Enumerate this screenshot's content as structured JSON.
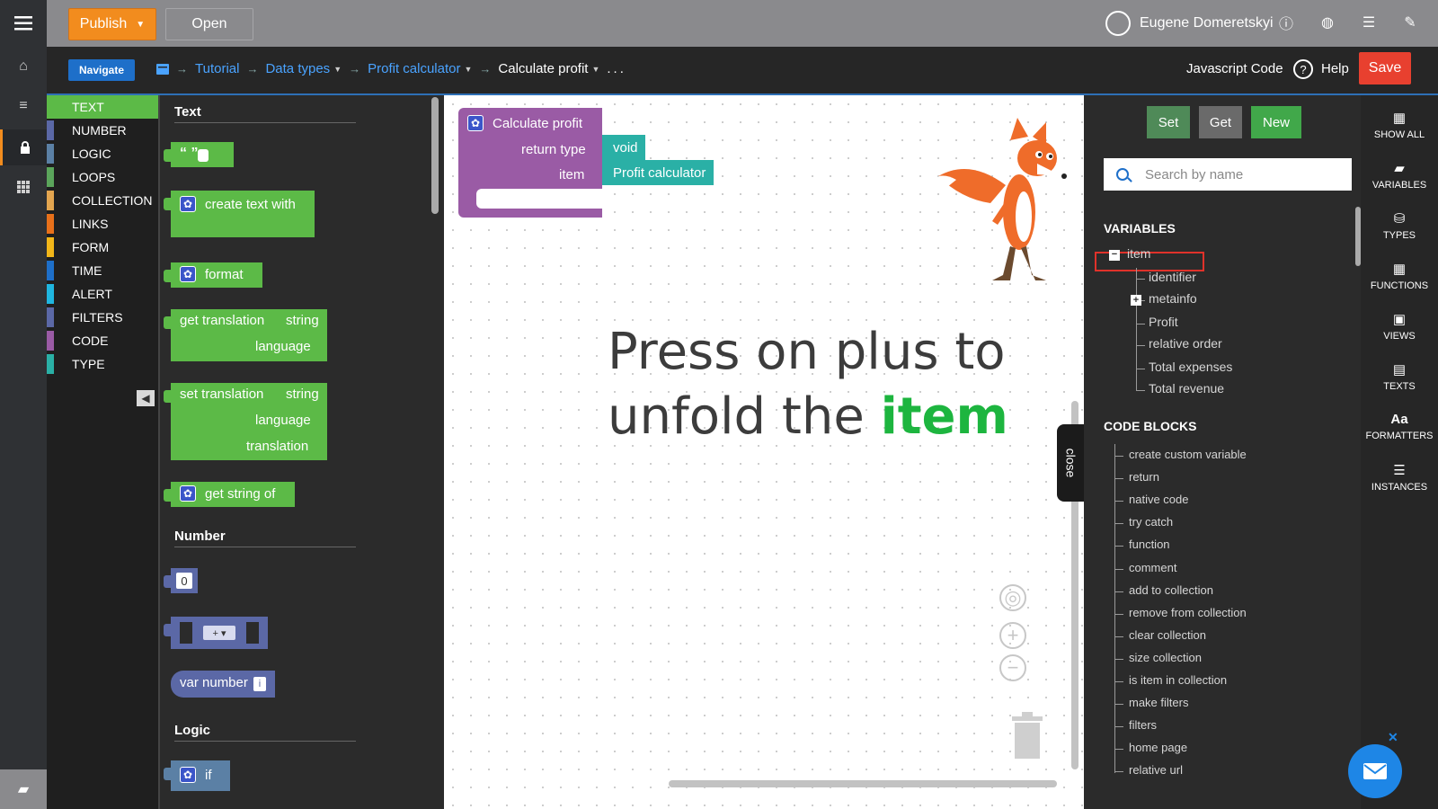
{
  "topbar": {
    "publish_label": "Publish",
    "open_label": "Open",
    "user_name": "Eugene Domeretskyi"
  },
  "navbar": {
    "navigate_label": "Navigate",
    "breadcrumbs": [
      "Tutorial",
      "Data types",
      "Profit calculator",
      "Calculate profit"
    ],
    "more": "...",
    "js_code_label": "Javascript Code",
    "help_label": "Help",
    "save_label": "Save"
  },
  "categories": [
    {
      "label": "TEXT",
      "color": "#5cba47"
    },
    {
      "label": "NUMBER",
      "color": "#5b68a6"
    },
    {
      "label": "LOGIC",
      "color": "#5b80a5"
    },
    {
      "label": "LOOPS",
      "color": "#5ba55b"
    },
    {
      "label": "COLLECTION",
      "color": "#e3a54f"
    },
    {
      "label": "LINKS",
      "color": "#e8701a"
    },
    {
      "label": "FORM",
      "color": "#f2b619"
    },
    {
      "label": "TIME",
      "color": "#1e6fc9"
    },
    {
      "label": "ALERT",
      "color": "#1fb6e0"
    },
    {
      "label": "FILTERS",
      "color": "#5b68a6"
    },
    {
      "label": "CODE",
      "color": "#9a5ba5"
    },
    {
      "label": "TYPE",
      "color": "#2ab0a6"
    }
  ],
  "flyout": {
    "text_title": "Text",
    "blocks": {
      "quote": "“ ”",
      "create_text": "create text with",
      "format": "format",
      "get_translation": "get translation",
      "string": "string",
      "language": "language",
      "set_translation": "set translation",
      "translation": "translation",
      "get_string": "get string of"
    },
    "number_title": "Number",
    "number_value": "0",
    "arith_op": "+ ▾",
    "var_number": "var number",
    "logic_title": "Logic",
    "if_label": "if",
    "close_label": "close"
  },
  "canvas": {
    "fn_title": "Calculate profit",
    "return_type_label": "return type",
    "return_type_value": "void",
    "item_label": "item",
    "item_value": "Profit calculator",
    "hint_line1": "Press on plus to",
    "hint_line2": "unfold the",
    "hint_highlight": "item",
    "close_label": "close"
  },
  "rpanel": {
    "set_label": "Set",
    "get_label": "Get",
    "new_label": "New",
    "search_placeholder": "Search by name",
    "variables_title": "VARIABLES",
    "variables": [
      "item",
      "identifier",
      "metainfo",
      "Profit",
      "relative order",
      "Total expenses",
      "Total revenue"
    ],
    "code_blocks_title": "CODE BLOCKS",
    "code_blocks": [
      "create custom variable",
      "return",
      "native code",
      "try catch",
      "function",
      "comment",
      "add to collection",
      "remove from collection",
      "clear collection",
      "size collection",
      "is item in collection",
      "make filters",
      "filters",
      "home page",
      "relative url"
    ]
  },
  "frail": {
    "show_all": "SHOW ALL",
    "variables": "VARIABLES",
    "types": "TYPES",
    "functions": "FUNCTIONS",
    "views": "VIEWS",
    "texts": "TEXTS",
    "formatters": "FORMATTERS",
    "formatters_icon": "Aa",
    "instances": "INSTANCES"
  }
}
